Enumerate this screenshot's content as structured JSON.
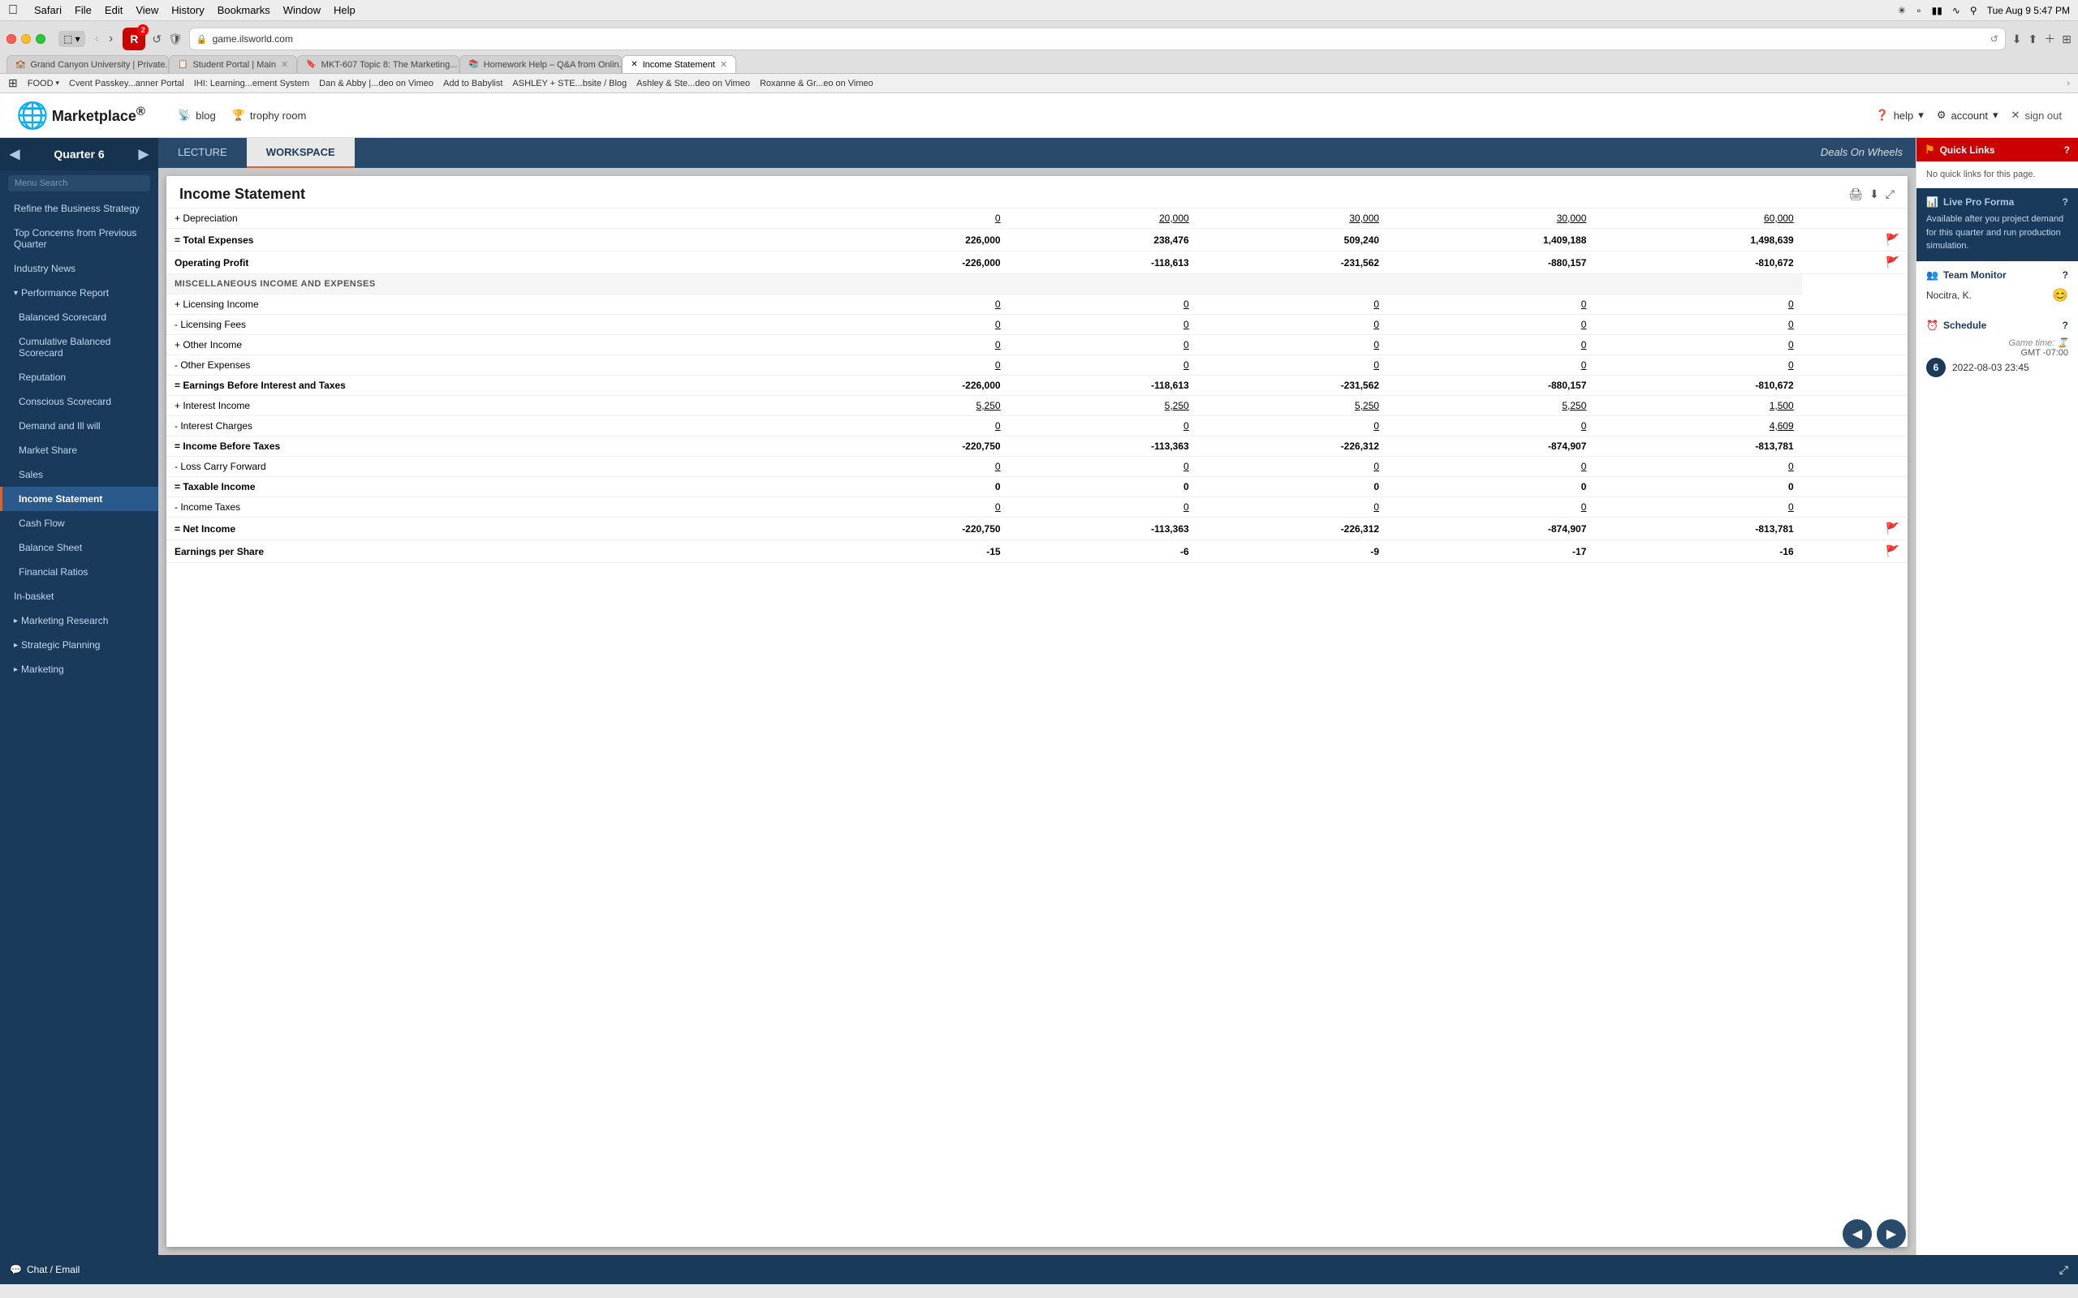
{
  "menubar": {
    "apple": "&#xF8FF;",
    "items": [
      "Safari",
      "File",
      "Edit",
      "View",
      "History",
      "Bookmarks",
      "Window",
      "Help"
    ],
    "right": {
      "time": "Tue Aug 9  5:47 PM",
      "icons": [
        "battery",
        "wifi",
        "bluetooth",
        "spotlight",
        "notification"
      ]
    }
  },
  "browser": {
    "tabs": [
      {
        "id": "gcu",
        "favicon": "🏫",
        "label": "Grand Canyon University | Private...",
        "active": false
      },
      {
        "id": "student",
        "favicon": "📋",
        "label": "Student Portal | Main",
        "active": false
      },
      {
        "id": "mkt",
        "favicon": "🔖",
        "label": "MKT-607 Topic 8: The Marketing...",
        "active": false
      },
      {
        "id": "hw",
        "favicon": "📚",
        "label": "Homework Help – Q&A from Onlin...",
        "active": false
      },
      {
        "id": "income",
        "favicon": "✖",
        "label": "Income Statement",
        "active": true
      }
    ],
    "address": "game.ilsworld.com",
    "bookmarks": [
      {
        "label": "FOOD",
        "has_arrow": true
      },
      {
        "label": "Cvent Passkey...anner Portal"
      },
      {
        "label": "IHI: Learning...ement System"
      },
      {
        "label": "Dan & Abby |...deo on Vimeo"
      },
      {
        "label": "Add to Babylist"
      },
      {
        "label": "ASHLEY + STE...bsite / Blog"
      },
      {
        "label": "Ashley & Ste...deo on Vimeo"
      },
      {
        "label": "Roxanne & Gr...eo on Vimeo"
      }
    ]
  },
  "app": {
    "logo": {
      "text": "Marketplace",
      "sub_text": "®"
    },
    "nav": {
      "blog_label": "blog",
      "trophy_label": "trophy room",
      "help_label": "help",
      "account_label": "account",
      "signout_label": "sign out"
    }
  },
  "sidebar": {
    "quarter_label": "Quarter 6",
    "search_placeholder": "Menu Search",
    "items": [
      {
        "id": "refine",
        "label": "Refine the Business Strategy",
        "level": 0,
        "active": false
      },
      {
        "id": "top-concerns",
        "label": "Top Concerns from Previous Quarter",
        "level": 0,
        "active": false
      },
      {
        "id": "industry-news",
        "label": "Industry News",
        "level": 0,
        "active": false
      },
      {
        "id": "performance",
        "label": "Performance Report",
        "level": 0,
        "is_group": true,
        "expanded": true
      },
      {
        "id": "balanced",
        "label": "Balanced Scorecard",
        "level": 1,
        "active": false
      },
      {
        "id": "cumulative",
        "label": "Cumulative Balanced Scorecard",
        "level": 1,
        "active": false
      },
      {
        "id": "reputation",
        "label": "Reputation",
        "level": 1,
        "active": false
      },
      {
        "id": "conscious",
        "label": "Conscious Scorecard",
        "level": 1,
        "active": false
      },
      {
        "id": "demand",
        "label": "Demand and Ill will",
        "level": 1,
        "active": false
      },
      {
        "id": "market-share",
        "label": "Market Share",
        "level": 1,
        "active": false
      },
      {
        "id": "sales",
        "label": "Sales",
        "level": 1,
        "active": false
      },
      {
        "id": "income-statement",
        "label": "Income Statement",
        "level": 1,
        "active": true
      },
      {
        "id": "cash-flow",
        "label": "Cash Flow",
        "level": 1,
        "active": false
      },
      {
        "id": "balance-sheet",
        "label": "Balance Sheet",
        "level": 1,
        "active": false
      },
      {
        "id": "financial-ratios",
        "label": "Financial Ratios",
        "level": 1,
        "active": false
      },
      {
        "id": "in-basket",
        "label": "In-basket",
        "level": 0,
        "active": false
      },
      {
        "id": "marketing-research",
        "label": "Marketing Research",
        "level": 0,
        "is_group": true,
        "expanded": false
      },
      {
        "id": "strategic-planning",
        "label": "Strategic Planning",
        "level": 0,
        "is_group": true,
        "expanded": false
      },
      {
        "id": "marketing",
        "label": "Marketing",
        "level": 0,
        "is_group": true,
        "expanded": false
      }
    ]
  },
  "workspace": {
    "tabs": [
      {
        "id": "lecture",
        "label": "LECTURE",
        "active": false
      },
      {
        "id": "workspace",
        "label": "WORKSPACE",
        "active": true
      }
    ],
    "game_title": "Deals On Wheels"
  },
  "income_statement": {
    "title": "Income Statement",
    "sections": [
      {
        "type": "row",
        "label": "+ Depreciation",
        "values": [
          "0",
          "20,000",
          "30,000",
          "30,000",
          "60,000"
        ],
        "underline": true,
        "bold": false
      },
      {
        "type": "row",
        "label": "= Total Expenses",
        "values": [
          "226,000",
          "238,476",
          "509,240",
          "1,409,188",
          "1,498,639"
        ],
        "bold": true,
        "flag": true
      },
      {
        "type": "row",
        "label": "Operating Profit",
        "values": [
          "-226,000",
          "-118,613",
          "-231,562",
          "-880,157",
          "-810,672"
        ],
        "bold": true,
        "flag": true
      },
      {
        "type": "section_header",
        "label": "MISCELLANEOUS INCOME AND EXPENSES"
      },
      {
        "type": "row",
        "label": "+ Licensing Income",
        "values": [
          "0",
          "0",
          "0",
          "0",
          "0"
        ],
        "underline": true
      },
      {
        "type": "row",
        "label": "- Licensing Fees",
        "values": [
          "0",
          "0",
          "0",
          "0",
          "0"
        ],
        "underline": true
      },
      {
        "type": "row",
        "label": "+ Other Income",
        "values": [
          "0",
          "0",
          "0",
          "0",
          "0"
        ],
        "underline": true
      },
      {
        "type": "row",
        "label": "- Other Expenses",
        "values": [
          "0",
          "0",
          "0",
          "0",
          "0"
        ],
        "underline": true
      },
      {
        "type": "row",
        "label": "= Earnings Before Interest and Taxes",
        "values": [
          "-226,000",
          "-118,613",
          "-231,562",
          "-880,157",
          "-810,672"
        ],
        "bold": true
      },
      {
        "type": "row",
        "label": "+ Interest Income",
        "values": [
          "5,250",
          "5,250",
          "5,250",
          "5,250",
          "1,500"
        ],
        "underline": true
      },
      {
        "type": "row",
        "label": "- Interest Charges",
        "values": [
          "0",
          "0",
          "0",
          "0",
          "4,609"
        ],
        "underline": true
      },
      {
        "type": "row",
        "label": "= Income Before Taxes",
        "values": [
          "-220,750",
          "-113,363",
          "-226,312",
          "-874,907",
          "-813,781"
        ],
        "bold": true
      },
      {
        "type": "row",
        "label": "- Loss Carry Forward",
        "values": [
          "0",
          "0",
          "0",
          "0",
          "0"
        ],
        "underline": true
      },
      {
        "type": "row",
        "label": "= Taxable Income",
        "values": [
          "0",
          "0",
          "0",
          "0",
          "0"
        ],
        "bold": true
      },
      {
        "type": "row",
        "label": "- Income Taxes",
        "values": [
          "0",
          "0",
          "0",
          "0",
          "0"
        ],
        "underline": true
      },
      {
        "type": "row",
        "label": "= Net Income",
        "values": [
          "-220,750",
          "-113,363",
          "-226,312",
          "-874,907",
          "-813,781"
        ],
        "bold": true,
        "flag": true
      },
      {
        "type": "row",
        "label": "Earnings per Share",
        "values": [
          "-15",
          "-6",
          "-9",
          "-17",
          "-16"
        ],
        "bold": true,
        "flag": true
      }
    ]
  },
  "quick_links": {
    "title": "Quick Links",
    "no_links_text": "No quick links for this page.",
    "live_proforma": {
      "title": "Live Pro Forma",
      "content": "Available after you project demand for this quarter and run production simulation."
    },
    "team_monitor": {
      "title": "Team Monitor",
      "member": "Nocitra, K.",
      "emoji": "😊"
    },
    "schedule": {
      "title": "Schedule",
      "game_time_label": "Game time:",
      "timezone": "GMT -07:00",
      "quarter": "6",
      "date": "2022-08-03 23:45"
    }
  },
  "chat": {
    "label": "Chat  / Email"
  },
  "nav_bottom": {
    "prev_arrow": "◀",
    "next_arrow": "▶"
  }
}
